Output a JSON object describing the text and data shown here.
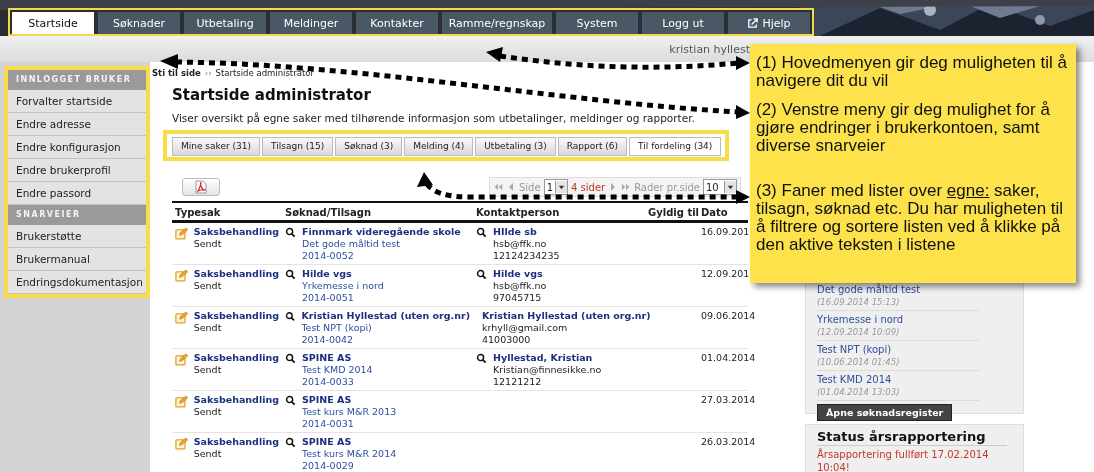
{
  "menu": [
    {
      "label": "Startside",
      "selected": true
    },
    {
      "label": "Søknader",
      "selected": false
    },
    {
      "label": "Utbetaling",
      "selected": false
    },
    {
      "label": "Meldinger",
      "selected": false
    },
    {
      "label": "Kontakter",
      "selected": false
    },
    {
      "label": "Ramme/regnskap",
      "selected": false
    },
    {
      "label": "System",
      "selected": false
    },
    {
      "label": "Logg ut",
      "selected": false
    },
    {
      "label": "Hjelp",
      "selected": false,
      "external": true
    }
  ],
  "user": "kristian hyllest",
  "sidebar": [
    {
      "heading": "INNLOGGET BRUKER",
      "items": [
        "Forvalter startside",
        "Endre adresse",
        "Endre konfigurasjon",
        "Endre brukerprofil",
        "Endre passord"
      ]
    },
    {
      "heading": "SNARVEIER",
      "items": [
        "Brukerstøtte",
        "Brukermanual",
        "Endringsdokumentasjon"
      ]
    }
  ],
  "breadcrumb": {
    "label": "Sti til side",
    "separator": "››",
    "current": "Startside administrator"
  },
  "title": "Startside administrator",
  "description": "Viser oversikt på egne saker med tilhørende informasjon som utbetalinger, meldinger og rapporter.",
  "tabs": [
    {
      "label": "Mine saker (31)",
      "selected": false
    },
    {
      "label": "Tilsagn (15)",
      "selected": false
    },
    {
      "label": "Søknad (3)",
      "selected": false
    },
    {
      "label": "Melding (4)",
      "selected": false
    },
    {
      "label": "Utbetaling (3)",
      "selected": false
    },
    {
      "label": "Rapport (6)",
      "selected": false
    },
    {
      "label": "Til fordeling (34)",
      "selected": true
    }
  ],
  "pager": {
    "page_label": "Side",
    "page": "1",
    "pages": "4 sider",
    "rows_label": "Rader pr.side",
    "rows": "10"
  },
  "table": {
    "columns": [
      "Typesak",
      "Søknad/Tilsagn",
      "Kontaktperson",
      "Gyldig til",
      "Dato"
    ],
    "rows": [
      {
        "type": "Saksbehandling",
        "status": "Sendt",
        "org": "Finnmark videregående skole",
        "project": "Det gode måltid test",
        "number": "2014-0052",
        "contact": "HIlde sb",
        "email": "hsb@ffk.no",
        "phone": "12124234235",
        "date": "16.09.201"
      },
      {
        "type": "Saksbehandling",
        "status": "Sendt",
        "org": "Hilde vgs",
        "project": "Yrkemesse i nord",
        "number": "2014-0051",
        "contact": "Hilde vgs",
        "email": "hsb@ffk.no",
        "phone": "97045715",
        "date": "12.09.201"
      },
      {
        "type": "Saksbehandling",
        "status": "Sendt",
        "org": "Kristian Hyllestad (uten org.nr)",
        "project": "Test NPT (kopi)",
        "number": "2014-0042",
        "contact": "Kristian Hyllestad (uten org.nr)",
        "email": "krhyll@gmail.com",
        "phone": "41003000",
        "date": "09.06.2014"
      },
      {
        "type": "Saksbehandling",
        "status": "Sendt",
        "org": "SPINE AS",
        "project": "Test KMD 2014",
        "number": "2014-0033",
        "contact": "Hyllestad, Kristian",
        "email": "Kristian@finnesikke.no",
        "phone": "12121212",
        "date": "01.04.2014"
      },
      {
        "type": "Saksbehandling",
        "status": "Sendt",
        "org": "SPINE AS",
        "project": "Test kurs M&R 2013",
        "number": "2014-0031",
        "date": "27.03.2014"
      },
      {
        "type": "Saksbehandling",
        "status": "Sendt",
        "org": "SPINE AS",
        "project": "Test kurs M&R 2014",
        "number": "2014-0029",
        "date": "26.03.2014"
      }
    ]
  },
  "recent": {
    "items": [
      {
        "title": "Det gode måltid test",
        "time": "(16.09.2014 15:13)"
      },
      {
        "title": "Yrkemesse i nord",
        "time": "(12.09.2014 10:09)"
      },
      {
        "title": "Test NPT (kopi)",
        "time": "(10.06.2014 01:45)"
      },
      {
        "title": "Test KMD 2014",
        "time": "(01.04.2014 13:03)"
      }
    ],
    "button": "Åpne søknadsregister"
  },
  "report_status": {
    "title": "Status årsrapportering",
    "message": "Årsapportering fullført 17.02.2014 10:04!"
  },
  "callout": [
    {
      "parts": [
        {
          "text": "(1) Hovedmenyen gir deg muligheten til å navigere dit du vil"
        }
      ]
    },
    {
      "parts": [
        {
          "text": "(2) Venstre meny gir deg mulighet for å gjøre endringer i brukerkontoen, samt diverse snarveier"
        }
      ]
    },
    {
      "parts": [
        {
          "text": "(3) Faner med lister over "
        },
        {
          "text": "egne:",
          "underline": true
        },
        {
          "text": " saker, tilsagn, søknad etc. Du har muligheten til å filtrere og sortere listen ved å klikke på den aktive teksten i listene"
        }
      ]
    }
  ]
}
